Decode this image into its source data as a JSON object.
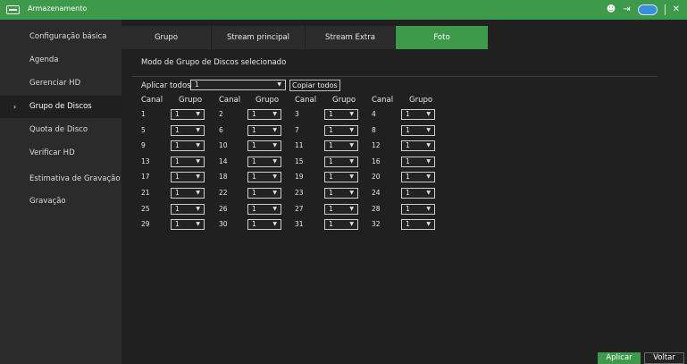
{
  "titlebar": {
    "title": "Armazenamento",
    "icons": [
      "storage-icon",
      "user-settings-icon",
      "logout-icon",
      "cloud-status-icon",
      "close-icon"
    ]
  },
  "sidebar": {
    "items": [
      {
        "label": "Configuração básica",
        "active": false
      },
      {
        "label": "Agenda",
        "active": false
      },
      {
        "label": "Gerenciar HD",
        "active": false
      },
      {
        "label": "Grupo de Discos",
        "active": true
      },
      {
        "label": "Quota de Disco",
        "active": false
      },
      {
        "label": "Verificar HD",
        "active": false
      },
      {
        "label": "Estimativa de Gravação",
        "active": false
      },
      {
        "label": "Gravação",
        "active": false
      }
    ]
  },
  "tabs": [
    {
      "label": "Grupo",
      "active": false
    },
    {
      "label": "Stream principal",
      "active": false
    },
    {
      "label": "Stream Extra",
      "active": false
    },
    {
      "label": "Foto",
      "active": true
    }
  ],
  "main": {
    "section_title": "Modo de Grupo de Discos selecionado",
    "apply_all_label": "Aplicar todos",
    "apply_all_value": "1",
    "copy_all_label": "Copiar todos",
    "col_channel": "Canal",
    "col_group": "Grupo"
  },
  "channels": [
    {
      "ch": "1",
      "group": "1"
    },
    {
      "ch": "2",
      "group": "1"
    },
    {
      "ch": "3",
      "group": "1"
    },
    {
      "ch": "4",
      "group": "1"
    },
    {
      "ch": "5",
      "group": "1"
    },
    {
      "ch": "6",
      "group": "1"
    },
    {
      "ch": "7",
      "group": "1"
    },
    {
      "ch": "8",
      "group": "1"
    },
    {
      "ch": "9",
      "group": "1"
    },
    {
      "ch": "10",
      "group": "1"
    },
    {
      "ch": "11",
      "group": "1"
    },
    {
      "ch": "12",
      "group": "1"
    },
    {
      "ch": "13",
      "group": "1"
    },
    {
      "ch": "14",
      "group": "1"
    },
    {
      "ch": "15",
      "group": "1"
    },
    {
      "ch": "16",
      "group": "1"
    },
    {
      "ch": "17",
      "group": "1"
    },
    {
      "ch": "18",
      "group": "1"
    },
    {
      "ch": "19",
      "group": "1"
    },
    {
      "ch": "20",
      "group": "1"
    },
    {
      "ch": "21",
      "group": "1"
    },
    {
      "ch": "22",
      "group": "1"
    },
    {
      "ch": "23",
      "group": "1"
    },
    {
      "ch": "24",
      "group": "1"
    },
    {
      "ch": "25",
      "group": "1"
    },
    {
      "ch": "26",
      "group": "1"
    },
    {
      "ch": "27",
      "group": "1"
    },
    {
      "ch": "28",
      "group": "1"
    },
    {
      "ch": "29",
      "group": "1"
    },
    {
      "ch": "30",
      "group": "1"
    },
    {
      "ch": "31",
      "group": "1"
    },
    {
      "ch": "32",
      "group": "1"
    }
  ],
  "buttons": {
    "apply": "Aplicar",
    "back": "Voltar"
  },
  "colors": {
    "accent": "#3d9a4b",
    "sidebar_bg": "#2b2b2b",
    "content_bg": "#202020"
  }
}
